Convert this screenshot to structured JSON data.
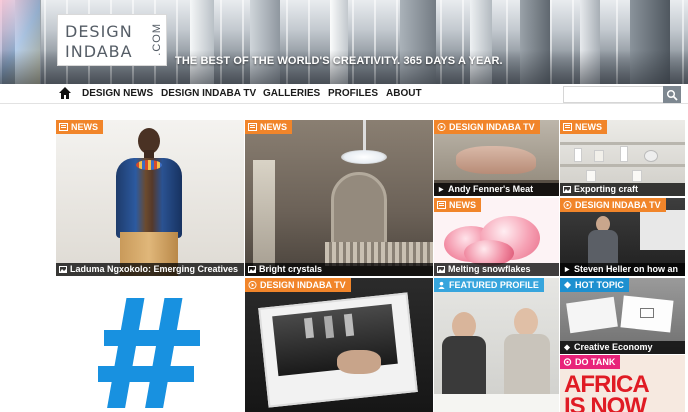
{
  "header": {
    "logo_line1": "DESIGN",
    "logo_line2": "INDABA",
    "logo_suffix": ".COM",
    "tagline": "THE BEST OF THE WORLD'S CREATIVITY. 365 DAYS A YEAR."
  },
  "nav": {
    "home_icon": "home-icon",
    "items": [
      {
        "label": "DESIGN NEWS"
      },
      {
        "label": "DESIGN INDABA TV"
      },
      {
        "label": "GALLERIES"
      },
      {
        "label": "PROFILES"
      },
      {
        "label": "ABOUT"
      }
    ],
    "search_placeholder": "",
    "search_icon": "search-icon"
  },
  "colors": {
    "news_badge": "#f1852a",
    "tv_badge": "#f1852a",
    "featured_badge": "#37a5dd",
    "hot_topic_badge": "#1d90d0",
    "do_tank_badge": "#e8237a",
    "hashtag": "#1891e0"
  },
  "tiles": [
    {
      "badge": "NEWS",
      "badge_icon": "news-icon",
      "caption": "Laduma Ngxokolo: Emerging Creatives",
      "caption_icon": "gallery-icon"
    },
    {
      "badge": "NEWS",
      "badge_icon": "news-icon",
      "caption": "Bright crystals",
      "caption_icon": "gallery-icon"
    },
    {
      "badge": "DESIGN INDABA TV",
      "badge_icon": "play-icon",
      "caption": "Andy Fenner's Meat",
      "caption_icon": "play-icon"
    },
    {
      "badge": "NEWS",
      "badge_icon": "news-icon",
      "caption": "Exporting craft",
      "caption_icon": "gallery-icon"
    },
    {
      "badge": "NEWS",
      "badge_icon": "news-icon",
      "caption": "Melting snowflakes",
      "caption_icon": "gallery-icon"
    },
    {
      "badge": "DESIGN INDABA TV",
      "badge_icon": "play-icon",
      "caption": "Steven Heller on how an",
      "caption_icon": "play-icon"
    },
    {
      "badge": "DESIGN INDABA TV",
      "badge_icon": "play-icon",
      "caption": "",
      "caption_icon": ""
    },
    {
      "badge": "FEATURED PROFILE",
      "badge_icon": "profile-icon",
      "caption": "",
      "caption_icon": ""
    },
    {
      "badge": "HOT TOPIC",
      "badge_icon": "hot-topic-icon",
      "caption": "Creative Economy",
      "caption_icon": "hot-topic-icon"
    },
    {
      "badge": "DO TANK",
      "badge_icon": "do-tank-icon",
      "caption": "",
      "caption_icon": ""
    }
  ],
  "hashtag_tile": {
    "symbol": "#"
  },
  "do_tank_poster": {
    "line1": "AFRICA",
    "line2": "IS NOW"
  }
}
